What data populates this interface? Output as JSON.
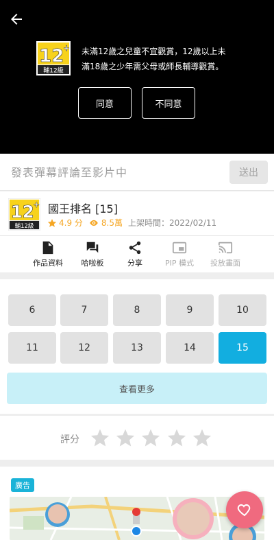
{
  "video": {
    "rating_badge": {
      "number": "12",
      "label": "輔12級"
    },
    "warning_line1": "未滿12歲之兒童不宜觀賞，12歲以上未",
    "warning_line2": "滿18歲之少年需父母或師長輔導觀賞。",
    "agree_label": "同意",
    "disagree_label": "不同意"
  },
  "danmaku": {
    "placeholder": "發表彈幕評論至影片中",
    "send_label": "送出"
  },
  "info": {
    "title": "國王排名 [15]",
    "score": "4.9 分",
    "views": "8.5萬",
    "release": "上架時間：2022/02/11",
    "badge_number": "12",
    "badge_label": "輔12級"
  },
  "actions": [
    {
      "label": "作品資料",
      "icon": "document-icon"
    },
    {
      "label": "哈啦板",
      "icon": "chat-icon"
    },
    {
      "label": "分享",
      "icon": "share-icon"
    },
    {
      "label": "PIP 模式",
      "icon": "pip-icon"
    },
    {
      "label": "投放畫面",
      "icon": "cast-icon"
    }
  ],
  "episodes": [
    "6",
    "7",
    "8",
    "9",
    "10",
    "11",
    "12",
    "13",
    "14",
    "15"
  ],
  "active_episode": "15",
  "more_label": "查看更多",
  "rating": {
    "label": "評分",
    "stars": 5
  },
  "ad": {
    "badge": "廣告"
  },
  "colors": {
    "accent": "#12aee0",
    "more_bg": "#c8f0f8",
    "orange": "#f5a623",
    "fab": "#f06a7f"
  }
}
